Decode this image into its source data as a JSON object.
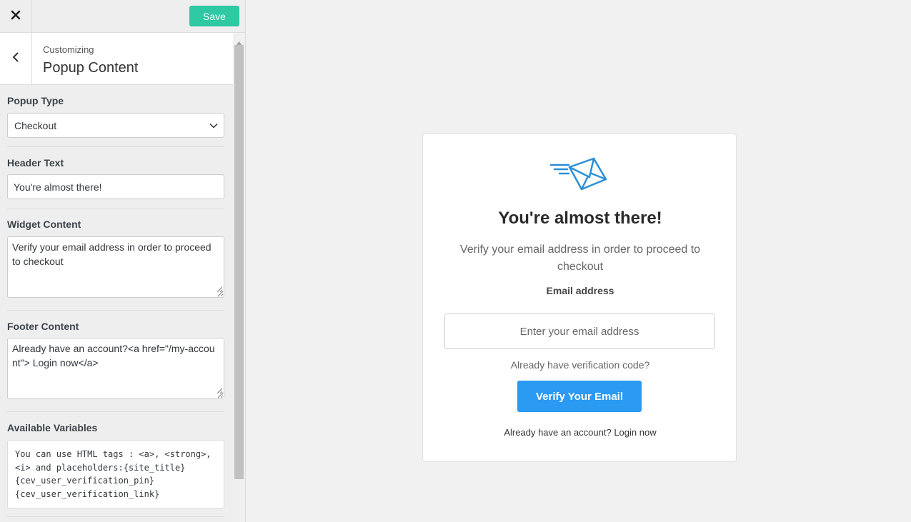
{
  "toolbar": {
    "save_label": "Save"
  },
  "header": {
    "subtitle": "Customizing",
    "title": "Popup Content"
  },
  "controls": {
    "popup_type": {
      "label": "Popup Type",
      "value": "Checkout"
    },
    "header_text": {
      "label": "Header Text",
      "value": "You're almost there!"
    },
    "widget_content": {
      "label": "Widget Content",
      "value": "Verify your email address in order to proceed to checkout"
    },
    "footer_content": {
      "label": "Footer Content",
      "value": "Already have an account?<a href=\"/my-account\"> Login now</a>"
    },
    "available_variables": {
      "label": "Available Variables",
      "value": "You can use HTML tags : <a>, <strong>,\n<i> and placeholders:{site_title}\n{cev_user_verification_pin}\n{cev_user_verification_link}"
    }
  },
  "popup": {
    "title": "You're almost there!",
    "content": "Verify your email address in order to proceed to checkout",
    "email_label": "Email address",
    "email_placeholder": "Enter your email address",
    "code_link": "Already have verification code?",
    "verify_button": "Verify Your Email",
    "footer_text": "Already have an account?",
    "footer_link": "Login now"
  },
  "icons": {
    "close": "close-icon",
    "back": "chevron-left-icon",
    "select": "chevron-down-icon",
    "envelope": "envelope-icon"
  },
  "colors": {
    "save_button": "#2ec8a3",
    "verify_button": "#2b9af3",
    "envelope": "#2b8fd6"
  }
}
